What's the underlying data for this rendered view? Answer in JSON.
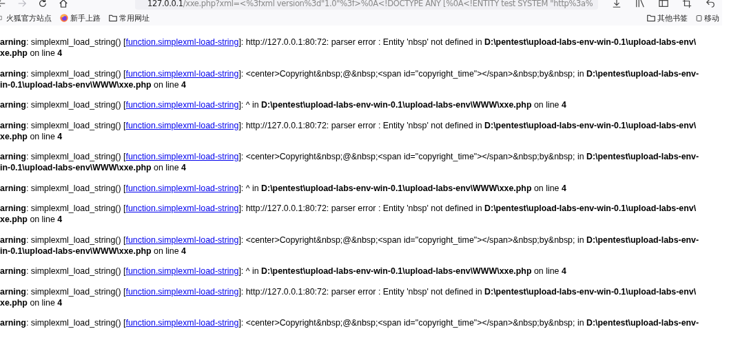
{
  "toolbar": {
    "back_disabled": false,
    "forward_disabled": true,
    "url_host": "127.0.0.1",
    "url_rest": "/xxe.php?xml=<%3fxml version%3d\"1.0\"%3f>%0A<!DOCTYPE ANY [%0A<!ENTITY test SYSTEM \"http%3a%"
  },
  "bookmarks_left": [
    {
      "kind": "page",
      "label": "火狐官方站点"
    },
    {
      "kind": "firefox",
      "label": "新手上路"
    },
    {
      "kind": "folder",
      "label": "常用网址"
    }
  ],
  "bookmarks_right": [
    {
      "kind": "folder",
      "label": "其他书签"
    },
    {
      "kind": "mobile",
      "label": "移动"
    }
  ],
  "messages": [
    {
      "lines": [
        {
          "before": "**arning**: simplexml_load_string() [",
          "link": "function.simplexml-load-string",
          "after": "]: http://127.0.0.1:80:72: parser error : Entity 'nbsp' not defined in **D:\\pentest\\upload-labs-env-win-0.1\\upload-labs-env\\**"
        },
        {
          "before": "**xe.php** on line **4**"
        }
      ]
    },
    {
      "lines": [
        {
          "before": "**arning**: simplexml_load_string() [",
          "link": "function.simplexml-load-string",
          "after": "]: <center>Copyright&nbsp;@&nbsp;<span id=\"copyright_time\"></span>&nbsp;by&nbsp; in **D:\\pentest\\upload-labs-env-**"
        },
        {
          "before": "**in-0.1\\upload-labs-env\\WWW\\xxe.php** on line **4**"
        }
      ]
    },
    {
      "lines": [
        {
          "before": "**arning**: simplexml_load_string() [",
          "link": "function.simplexml-load-string",
          "after": "]: ^ in **D:\\pentest\\upload-labs-env-win-0.1\\upload-labs-env\\WWW\\xxe.php** on line **4**"
        }
      ]
    },
    {
      "lines": [
        {
          "before": "**arning**: simplexml_load_string() [",
          "link": "function.simplexml-load-string",
          "after": "]: http://127.0.0.1:80:72: parser error : Entity 'nbsp' not defined in **D:\\pentest\\upload-labs-env-win-0.1\\upload-labs-env\\**"
        },
        {
          "before": "**xe.php** on line **4**"
        }
      ]
    },
    {
      "lines": [
        {
          "before": "**arning**: simplexml_load_string() [",
          "link": "function.simplexml-load-string",
          "after": "]: <center>Copyright&nbsp;@&nbsp;<span id=\"copyright_time\"></span>&nbsp;by&nbsp; in **D:\\pentest\\upload-labs-env-**"
        },
        {
          "before": "**in-0.1\\upload-labs-env\\WWW\\xxe.php** on line **4**"
        }
      ]
    },
    {
      "lines": [
        {
          "before": "**arning**: simplexml_load_string() [",
          "link": "function.simplexml-load-string",
          "after": "]: ^ in **D:\\pentest\\upload-labs-env-win-0.1\\upload-labs-env\\WWW\\xxe.php** on line **4**"
        }
      ]
    },
    {
      "lines": [
        {
          "before": "**arning**: simplexml_load_string() [",
          "link": "function.simplexml-load-string",
          "after": "]: http://127.0.0.1:80:72: parser error : Entity 'nbsp' not defined in **D:\\pentest\\upload-labs-env-win-0.1\\upload-labs-env\\**"
        },
        {
          "before": "**xe.php** on line **4**"
        }
      ]
    },
    {
      "lines": [
        {
          "before": "**arning**: simplexml_load_string() [",
          "link": "function.simplexml-load-string",
          "after": "]: <center>Copyright&nbsp;@&nbsp;<span id=\"copyright_time\"></span>&nbsp;by&nbsp; in **D:\\pentest\\upload-labs-env-**"
        },
        {
          "before": "**in-0.1\\upload-labs-env\\WWW\\xxe.php** on line **4**"
        }
      ]
    },
    {
      "lines": [
        {
          "before": "**arning**: simplexml_load_string() [",
          "link": "function.simplexml-load-string",
          "after": "]: ^ in **D:\\pentest\\upload-labs-env-win-0.1\\upload-labs-env\\WWW\\xxe.php** on line **4**"
        }
      ]
    },
    {
      "lines": [
        {
          "before": "**arning**: simplexml_load_string() [",
          "link": "function.simplexml-load-string",
          "after": "]: http://127.0.0.1:80:72: parser error : Entity 'nbsp' not defined in **D:\\pentest\\upload-labs-env-win-0.1\\upload-labs-env\\**"
        },
        {
          "before": "**xe.php** on line **4**"
        }
      ]
    },
    {
      "lines": [
        {
          "before": "**arning**: simplexml_load_string() [",
          "link": "function.simplexml-load-string",
          "after": "]: <center>Copyright&nbsp;@&nbsp;<span id=\"copyright_time\"></span>&nbsp;by&nbsp; in **D:\\pentest\\upload-labs-env-**"
        }
      ]
    }
  ]
}
